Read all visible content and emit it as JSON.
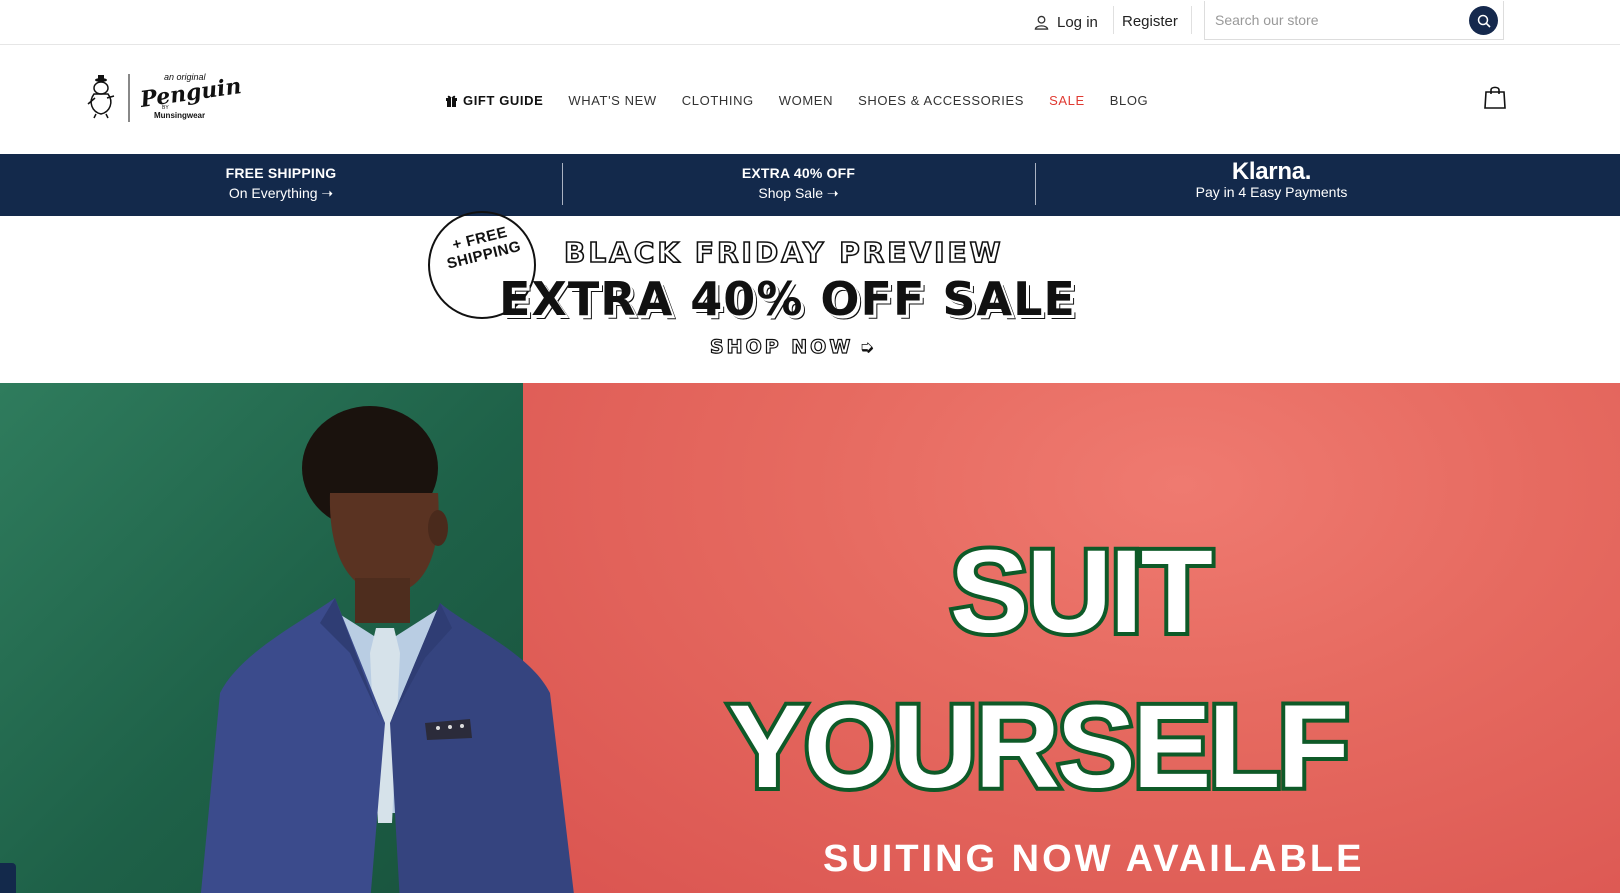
{
  "utility": {
    "login_label": "Log in",
    "register_label": "Register",
    "search_placeholder": "Search our store"
  },
  "logo": {
    "line1": "an original",
    "line2": "Penguin",
    "line3": "BY",
    "line4": "Munsingwear"
  },
  "nav": {
    "items": [
      {
        "label": "GIFT GUIDE",
        "icon": "gift-icon"
      },
      {
        "label": "WHAT'S NEW"
      },
      {
        "label": "CLOTHING"
      },
      {
        "label": "WOMEN"
      },
      {
        "label": "SHOES & ACCESSORIES"
      },
      {
        "label": "SALE",
        "color": "#e03a32"
      },
      {
        "label": "BLOG"
      }
    ]
  },
  "promo": {
    "shipping_title": "FREE SHIPPING",
    "shipping_sub": "On Everything ➝",
    "sale_title": "EXTRA 40% OFF",
    "sale_sub": "Shop Sale ➝",
    "klarna_brand": "Klarna.",
    "klarna_sub": "Pay in 4 Easy Payments",
    "background": "#13294b"
  },
  "banner": {
    "badge_line1": "+ FREE",
    "badge_line2": "SHIPPING",
    "preview": "BLACK FRIDAY PREVIEW",
    "headline": "EXTRA 40% OFF SALE",
    "cta": "SHOP NOW"
  },
  "hero": {
    "line1": "SUIT",
    "line2": "YOURSELF",
    "subline": "SUITING NOW AVAILABLE",
    "colors": {
      "green_panel": "#1e6148",
      "red_panel": "#e66a60",
      "text_outline": "#0e5a28"
    }
  }
}
